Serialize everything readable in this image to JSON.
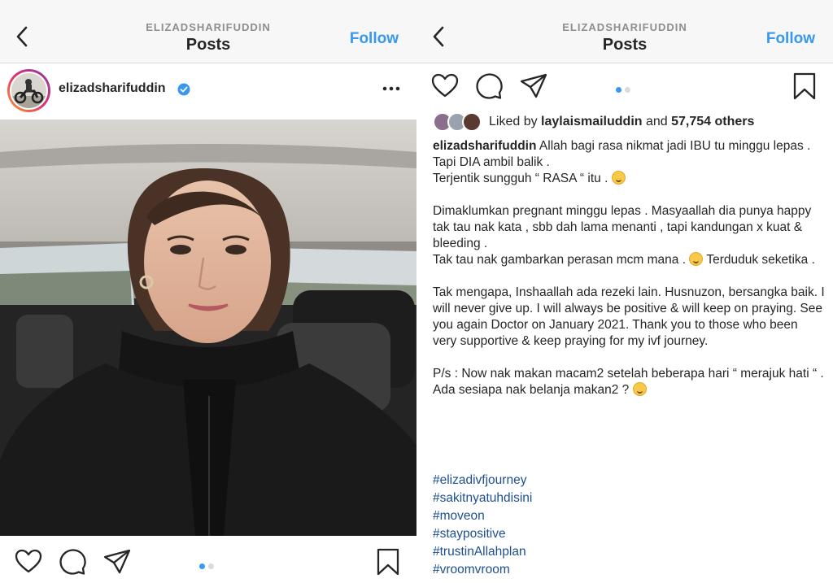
{
  "left": {
    "header": {
      "username": "ELIZADSHARIFUDDIN",
      "title": "Posts",
      "follow_label": "Follow"
    },
    "post": {
      "username": "elizadsharifuddin",
      "more_icon": "more-horizontal-icon"
    },
    "carousel": {
      "current": 1,
      "total": 2
    }
  },
  "right": {
    "header": {
      "username": "ELIZADSHARIFUDDIN",
      "title": "Posts",
      "follow_label": "Follow"
    },
    "carousel": {
      "current": 1,
      "total": 2
    },
    "likes": {
      "prefix": "Liked by ",
      "user": "laylaismailuddin",
      "middle": " and ",
      "others": "57,754 others"
    },
    "caption": {
      "username": "elizadsharifuddin",
      "line1": " Allah bagi rasa nikmat jadi IBU tu minggu lepas .",
      "line2": "Tapi DIA ambil balik .",
      "line3": "Terjentik sungguh “ RASA “ itu .",
      "para2a": "Dimaklumkan pregnant minggu lepas . Masyaallah dia punya happy tak tau nak kata , sbb dah lama menanti , tapi kandungan x kuat & bleeding .",
      "para2b": "Tak tau nak gambarkan perasan mcm mana .",
      "para2c": " Terduduk seketika .",
      "para3": "Tak mengapa, Inshaallah ada rezeki lain. Husnuzon, bersangka baik. I will never give up. I will always be positive & will keep on praying. See you again Doctor on January 2021. Thank you to those who been very supportive & keep praying for my ivf journey.",
      "para4": "P/s : Now nak makan macam2 setelah beberapa hari “ merajuk hati “ . Ada sesiapa nak belanja makan2 ?"
    },
    "hashtags": [
      "#elizadivfjourney",
      "#sakitnyatuhdisini",
      "#moveon",
      "#staypositive",
      "#trustinAllahplan",
      "#vroomvroom"
    ]
  },
  "colors": {
    "accent": "#3897f0",
    "hashtag": "#1e4f8f",
    "header_bg": "#f7f7f7"
  }
}
